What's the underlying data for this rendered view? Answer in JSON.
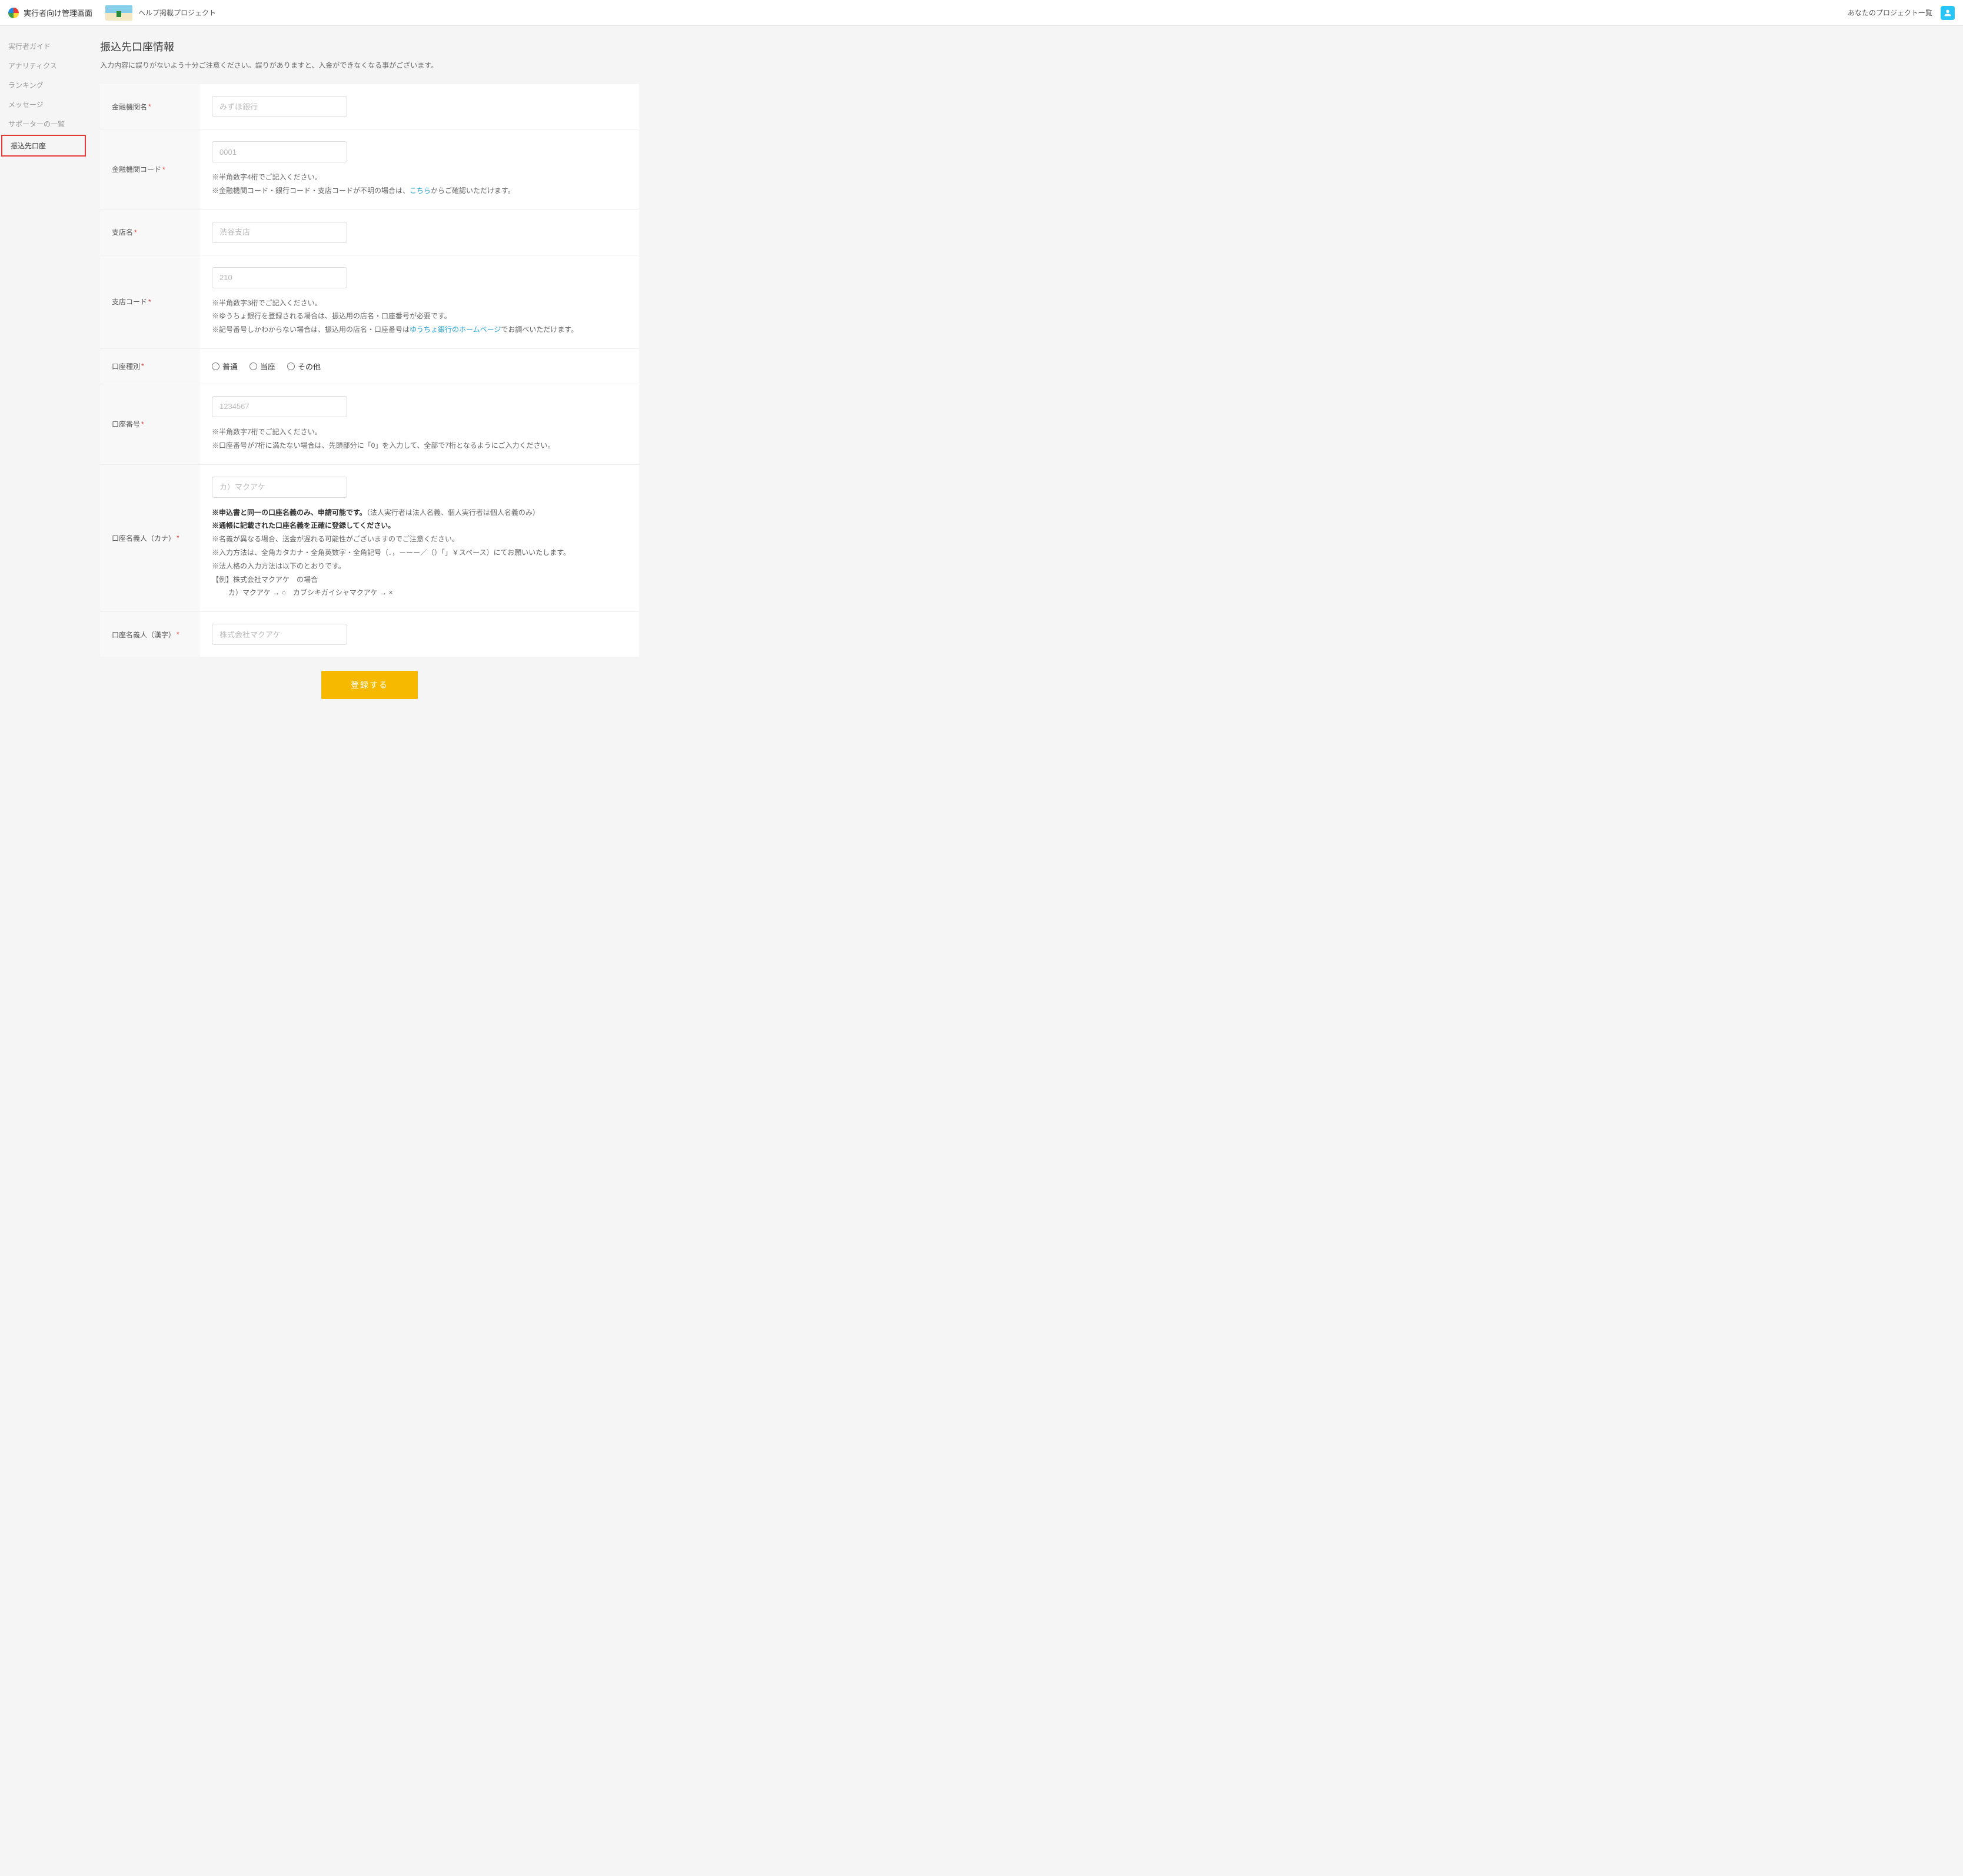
{
  "header": {
    "app_title": "実行者向け管理画面",
    "project_name": "ヘルプ掲載プロジェクト",
    "right_link": "あなたのプロジェクト一覧"
  },
  "sidebar": {
    "items": [
      "実行者ガイド",
      "アナリティクス",
      "ランキング",
      "メッセージ",
      "サポーターの一覧",
      "振込先口座"
    ]
  },
  "page": {
    "title": "振込先口座情報",
    "sub": "入力内容に誤りがないよう十分ご注意ください。誤りがありますと、入金ができなくなる事がございます。"
  },
  "form": {
    "bank_name": {
      "label": "金融機関名",
      "placeholder": "みずほ銀行"
    },
    "bank_code": {
      "label": "金融機関コード",
      "placeholder": "0001",
      "help1": "※半角数字4桁でご記入ください。",
      "help2_pre": "※金融機関コード・銀行コード・支店コードが不明の場合は、",
      "help2_link": "こちら",
      "help2_post": "からご確認いただけます。"
    },
    "branch_name": {
      "label": "支店名",
      "placeholder": "渋谷支店"
    },
    "branch_code": {
      "label": "支店コード",
      "placeholder": "210",
      "help1": "※半角数字3桁でご記入ください。",
      "help2": "※ゆうちょ銀行を登録される場合は、振込用の店名・口座番号が必要です。",
      "help3_pre": "※記号番号しかわからない場合は、振込用の店名・口座番号は",
      "help3_link": "ゆうちょ銀行のホームページ",
      "help3_post": "でお調べいただけます。"
    },
    "account_type": {
      "label": "口座種別",
      "options": [
        "普通",
        "当座",
        "その他"
      ]
    },
    "account_number": {
      "label": "口座番号",
      "placeholder": "1234567",
      "help1": "※半角数字7桁でご記入ください。",
      "help2": "※口座番号が7桁に満たない場合は、先頭部分に「0」を入力して、全部で7桁となるようにご入力ください。"
    },
    "holder_kana": {
      "label": "口座名義人（カナ）",
      "placeholder": "カ）マクアケ",
      "help1_pre": "※申込書と同一の口座名義のみ、申請可能です。",
      "help1_post": "（法人実行者は法人名義、個人実行者は個人名義のみ）",
      "help2": "※通帳に記載された口座名義を正確に登録してください。",
      "help3": "※名義が異なる場合、送金が遅れる可能性がございますのでご注意ください。",
      "help4": "※入力方法は、全角カタカナ・全角英数字・全角記号（．，－ーー／（）「」￥スペース）にてお願いいたします。",
      "help5": "※法人格の入力方法は以下のとおりです。",
      "help6": "【例】株式会社マクアケ　の場合",
      "help7": "カ）マクアケ → ○　カブシキガイシャマクアケ → ×"
    },
    "holder_kanji": {
      "label": "口座名義人（漢字）",
      "placeholder": "株式会社マクアケ"
    },
    "submit": "登録する"
  }
}
